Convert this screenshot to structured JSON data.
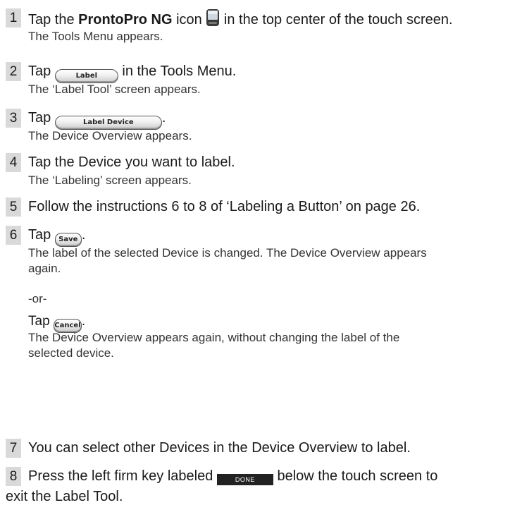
{
  "steps": [
    {
      "num": "1",
      "pre": "Tap the ",
      "bold": "ProntoPro NG",
      "mid": " icon ",
      "post": " in the top center of the touch screen.",
      "result": "The Tools Menu appears."
    },
    {
      "num": "2",
      "pre": "Tap ",
      "button": "Label",
      "post": " in the Tools Menu.",
      "result": "The ‘Label Tool’ screen appears."
    },
    {
      "num": "3",
      "pre": "Tap ",
      "button": "Label Device",
      "post": ".",
      "result": "The Device Overview appears."
    },
    {
      "num": "4",
      "text": "Tap the Device you want to label.",
      "result": "The ‘Labeling’ screen appears."
    },
    {
      "num": "5",
      "text": "Follow the instructions 6 to 8 of ‘Labeling a Button’ on page 26."
    },
    {
      "num": "6",
      "pre": "Tap ",
      "button": "Save",
      "post": ".",
      "result_line1": "The label of the selected Device is changed. The Device Overview appears",
      "result_line2": "again.",
      "or": "-or-",
      "alt_pre": "Tap ",
      "alt_button": "Cancel",
      "alt_post": ".",
      "alt_line1": "The Device Overview appears again, without changing the label of the",
      "alt_line2": "selected device."
    },
    {
      "num": "7",
      "text": "You can select other Devices in the Device Overview to label."
    },
    {
      "num": "8",
      "pre": "Press the left firm key labeled ",
      "key": "DONE",
      "post": " below the touch screen to",
      "line2": "exit the Label Tool."
    }
  ],
  "icons": {
    "device": "remote-device-icon"
  }
}
